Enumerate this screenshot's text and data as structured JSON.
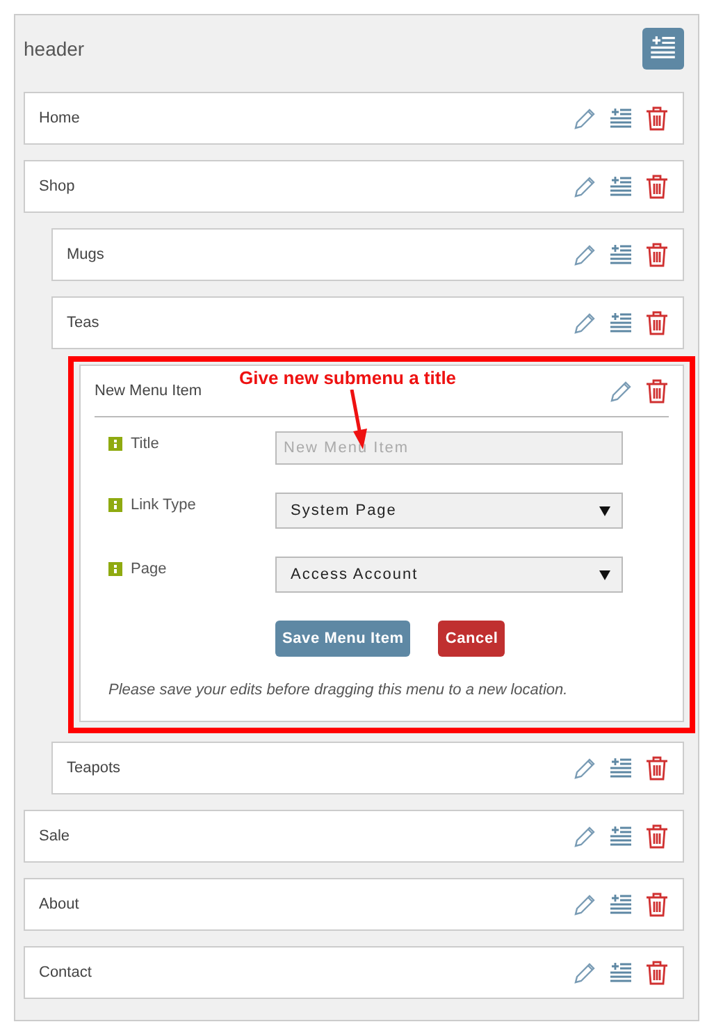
{
  "header": {
    "title": "header"
  },
  "items": [
    {
      "kind": "item",
      "label": "Home"
    },
    {
      "kind": "item",
      "label": "Shop",
      "children": [
        {
          "kind": "item",
          "label": "Mugs"
        },
        {
          "kind": "item",
          "label": "Teas",
          "children": [
            {
              "kind": "editor",
              "label": "New Menu Item",
              "annotation": "Give new submenu a title",
              "fields": [
                {
                  "kind": "text",
                  "label": "Title",
                  "placeholder": "New Menu Item"
                },
                {
                  "kind": "select",
                  "label": "Link Type",
                  "value": "System Page"
                },
                {
                  "kind": "select",
                  "label": "Page",
                  "value": "Access Account"
                }
              ],
              "save": "Save Menu Item",
              "cancel": "Cancel",
              "note": "Please save your edits before dragging this menu to a new location."
            }
          ]
        },
        {
          "kind": "item",
          "label": "Teapots"
        }
      ]
    },
    {
      "kind": "item",
      "label": "Sale"
    },
    {
      "kind": "item",
      "label": "About"
    },
    {
      "kind": "item",
      "label": "Contact"
    }
  ]
}
